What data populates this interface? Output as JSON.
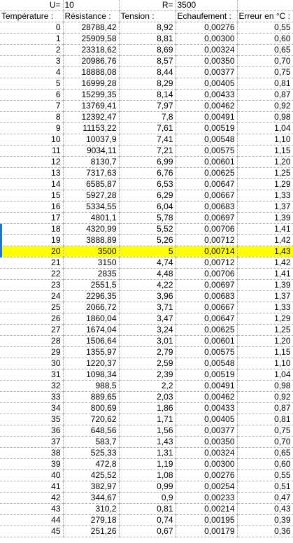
{
  "param_row": {
    "u_label": "U=",
    "u_value": "10",
    "r_label": "R=",
    "r_value": "3500"
  },
  "headers": [
    "Température :",
    "Résistance :",
    "Tension :",
    "Echaufement :",
    "Erreur en °C :"
  ],
  "highlight_row_index": 20,
  "rows": [
    [
      "0",
      "28788,42",
      "8,92",
      "0,00276",
      "0,55"
    ],
    [
      "1",
      "25909,58",
      "8,81",
      "0,00300",
      "0,60"
    ],
    [
      "2",
      "23318,62",
      "8,69",
      "0,00324",
      "0,65"
    ],
    [
      "3",
      "20986,76",
      "8,57",
      "0,00350",
      "0,70"
    ],
    [
      "4",
      "18888,08",
      "8,44",
      "0,00377",
      "0,75"
    ],
    [
      "5",
      "16999,28",
      "8,29",
      "0,00405",
      "0,81"
    ],
    [
      "6",
      "15299,35",
      "8,14",
      "0,00433",
      "0,87"
    ],
    [
      "7",
      "13769,41",
      "7,97",
      "0,00462",
      "0,92"
    ],
    [
      "8",
      "12392,47",
      "7,8",
      "0,00491",
      "0,98"
    ],
    [
      "9",
      "11153,22",
      "7,61",
      "0,00519",
      "1,04"
    ],
    [
      "10",
      "10037,9",
      "7,41",
      "0,00548",
      "1,10"
    ],
    [
      "11",
      "9034,11",
      "7,21",
      "0,00575",
      "1,15"
    ],
    [
      "12",
      "8130,7",
      "6,99",
      "0,00601",
      "1,20"
    ],
    [
      "13",
      "7317,63",
      "6,76",
      "0,00625",
      "1,25"
    ],
    [
      "14",
      "6585,87",
      "6,53",
      "0,00647",
      "1,29"
    ],
    [
      "15",
      "5927,28",
      "6,29",
      "0,00667",
      "1,33"
    ],
    [
      "16",
      "5334,55",
      "6,04",
      "0,00683",
      "1,37"
    ],
    [
      "17",
      "4801,1",
      "5,78",
      "0,00697",
      "1,39"
    ],
    [
      "18",
      "4320,99",
      "5,52",
      "0,00706",
      "1,41"
    ],
    [
      "19",
      "3888,89",
      "5,26",
      "0,00712",
      "1,42"
    ],
    [
      "20",
      "3500",
      "5",
      "0,00714",
      "1,43"
    ],
    [
      "21",
      "3150",
      "4,74",
      "0,00712",
      "1,42"
    ],
    [
      "22",
      "2835",
      "4,48",
      "0,00706",
      "1,41"
    ],
    [
      "23",
      "2551,5",
      "4,22",
      "0,00697",
      "1,39"
    ],
    [
      "24",
      "2296,35",
      "3,96",
      "0,00683",
      "1,37"
    ],
    [
      "25",
      "2066,72",
      "3,71",
      "0,00667",
      "1,33"
    ],
    [
      "26",
      "1860,04",
      "3,47",
      "0,00647",
      "1,29"
    ],
    [
      "27",
      "1674,04",
      "3,24",
      "0,00625",
      "1,25"
    ],
    [
      "28",
      "1506,64",
      "3,01",
      "0,00601",
      "1,20"
    ],
    [
      "29",
      "1355,97",
      "2,79",
      "0,00575",
      "1,15"
    ],
    [
      "30",
      "1220,37",
      "2,59",
      "0,00548",
      "1,10"
    ],
    [
      "31",
      "1098,34",
      "2,39",
      "0,00519",
      "1,04"
    ],
    [
      "32",
      "988,5",
      "2,2",
      "0,00491",
      "0,98"
    ],
    [
      "33",
      "889,65",
      "2,03",
      "0,00462",
      "0,92"
    ],
    [
      "34",
      "800,69",
      "1,86",
      "0,00433",
      "0,87"
    ],
    [
      "35",
      "720,62",
      "1,71",
      "0,00405",
      "0,81"
    ],
    [
      "36",
      "648,56",
      "1,56",
      "0,00377",
      "0,75"
    ],
    [
      "37",
      "583,7",
      "1,43",
      "0,00350",
      "0,70"
    ],
    [
      "38",
      "525,33",
      "1,31",
      "0,00324",
      "0,65"
    ],
    [
      "39",
      "472,8",
      "1,19",
      "0,00300",
      "0,60"
    ],
    [
      "40",
      "425,52",
      "1,08",
      "0,00276",
      "0,55"
    ],
    [
      "41",
      "382,97",
      "0,99",
      "0,00254",
      "0,51"
    ],
    [
      "42",
      "344,67",
      "0,9",
      "0,00233",
      "0,47"
    ],
    [
      "43",
      "310,2",
      "0,81",
      "0,00214",
      "0,43"
    ],
    [
      "44",
      "279,18",
      "0,74",
      "0,00195",
      "0,39"
    ],
    [
      "45",
      "251,26",
      "0,67",
      "0,00179",
      "0,36"
    ]
  ],
  "colors": {
    "highlight": "#ffff00",
    "gridline": "#b0b0b0",
    "selection_marker": "#1f77d0"
  }
}
